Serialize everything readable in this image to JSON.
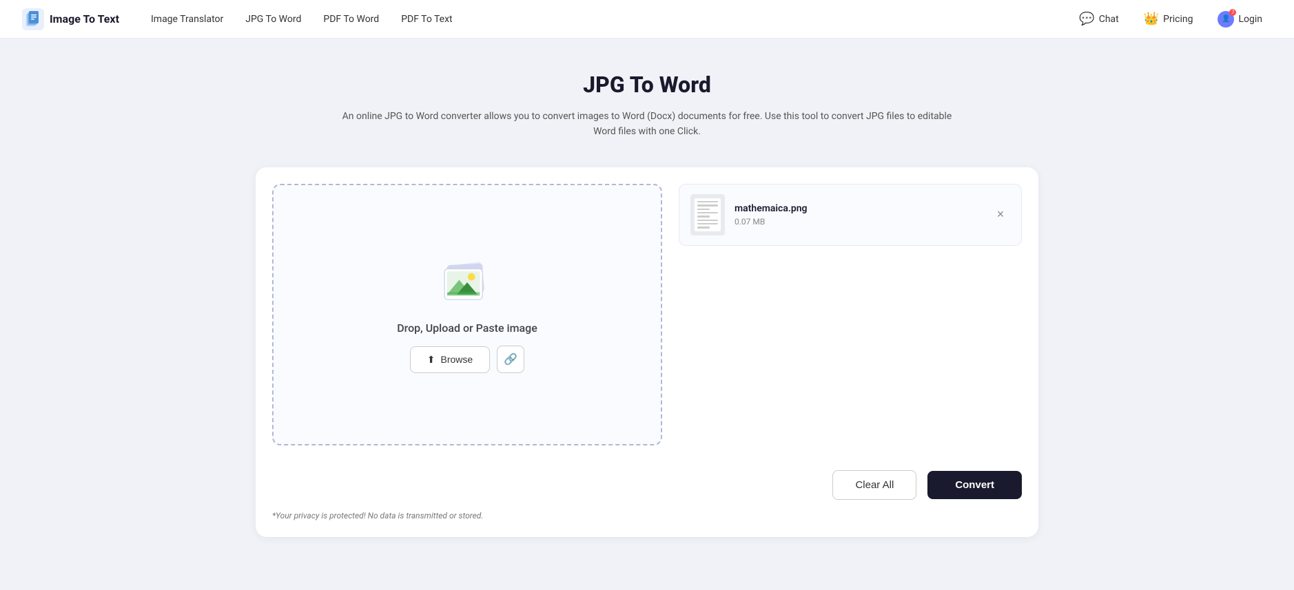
{
  "brand": {
    "name": "Image To Text",
    "logo_alt": "image-to-text-logo"
  },
  "nav": {
    "links": [
      {
        "label": "Image Translator",
        "id": "image-translator"
      },
      {
        "label": "JPG To Word",
        "id": "jpg-to-word"
      },
      {
        "label": "PDF To Word",
        "id": "pdf-to-word"
      },
      {
        "label": "PDF To Text",
        "id": "pdf-to-text"
      }
    ],
    "chat_label": "Chat",
    "pricing_label": "Pricing",
    "login_label": "Login",
    "notification_count": "7"
  },
  "page": {
    "title": "JPG To Word",
    "subtitle": "An online JPG to Word converter allows you to convert images to Word (Docx) documents for free. Use this tool to convert JPG files to editable Word files with one Click."
  },
  "dropzone": {
    "text": "Drop, Upload or Paste image",
    "browse_label": "Browse",
    "upload_icon": "⬆",
    "link_icon": "🔗"
  },
  "file": {
    "name": "mathemaica.png",
    "size": "0.07 MB"
  },
  "actions": {
    "clear_label": "Clear All",
    "convert_label": "Convert"
  },
  "privacy": {
    "note": "*Your privacy is protected! No data is transmitted or stored."
  }
}
